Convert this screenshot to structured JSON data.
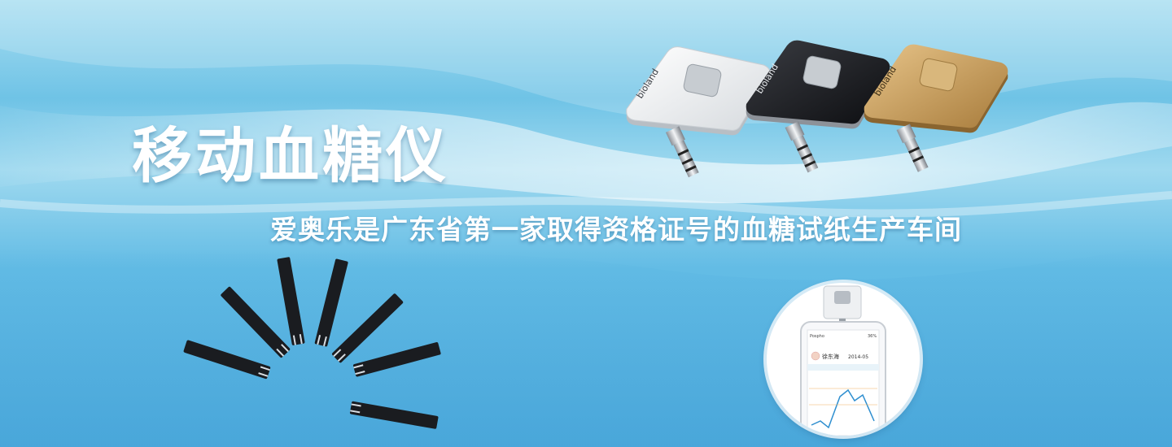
{
  "banner": {
    "title": "移动血糖仪",
    "subtitle": "爱奥乐是广东省第一家取得资格证号的血糖试纸生产车间"
  },
  "devices": [
    {
      "brand": "bioland",
      "color": "white"
    },
    {
      "brand": "bioland",
      "color": "black"
    },
    {
      "brand": "bioland",
      "color": "gold"
    }
  ],
  "test_strips": {
    "count": 7
  },
  "phone_screen": {
    "status_carrier": "Pospho",
    "status_battery": "36%",
    "user_name": "徐东海",
    "date": "2014-05"
  },
  "colors": {
    "background_top": "#a9def1",
    "background_bottom": "#5ab3e0",
    "text": "#ffffff",
    "device_white": "#eef0f2",
    "device_black": "#1a1b1f",
    "device_gold": "#c9a05e"
  }
}
